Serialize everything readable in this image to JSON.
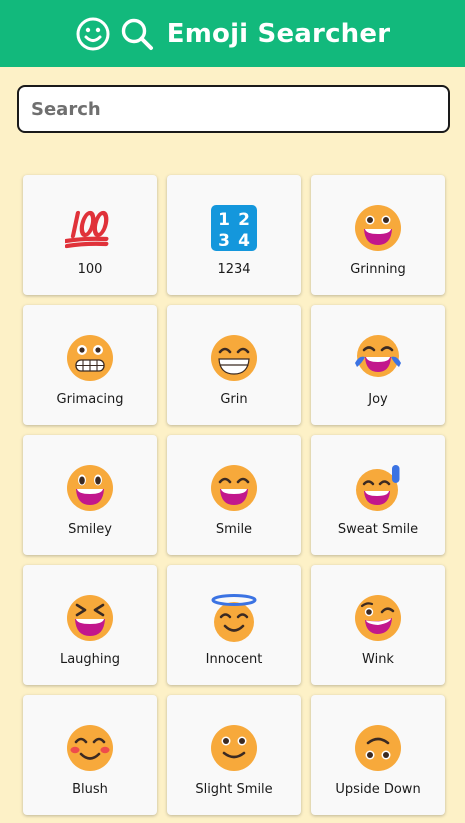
{
  "header": {
    "title": "Emoji Searcher"
  },
  "search": {
    "placeholder": "Search",
    "value": ""
  },
  "colors": {
    "header_bg": "#12b97c",
    "page_bg": "#fdf1c7",
    "face": "#f7a93b",
    "mouth": "#c2178c"
  },
  "emojis": [
    {
      "label": "100",
      "icon": "hundred-points-icon"
    },
    {
      "label": "1234",
      "icon": "input-numbers-icon"
    },
    {
      "label": "Grinning",
      "icon": "grinning-face-icon"
    },
    {
      "label": "Grimacing",
      "icon": "grimacing-face-icon"
    },
    {
      "label": "Grin",
      "icon": "beaming-face-icon"
    },
    {
      "label": "Joy",
      "icon": "tears-of-joy-face-icon"
    },
    {
      "label": "Smiley",
      "icon": "smiley-face-icon"
    },
    {
      "label": "Smile",
      "icon": "smile-face-icon"
    },
    {
      "label": "Sweat Smile",
      "icon": "sweat-smile-face-icon"
    },
    {
      "label": "Laughing",
      "icon": "laughing-face-icon"
    },
    {
      "label": "Innocent",
      "icon": "halo-face-icon"
    },
    {
      "label": "Wink",
      "icon": "winking-face-icon"
    },
    {
      "label": "Blush",
      "icon": "blushing-face-icon"
    },
    {
      "label": "Slight Smile",
      "icon": "slight-smile-face-icon"
    },
    {
      "label": "Upside Down",
      "icon": "upside-down-face-icon"
    }
  ]
}
